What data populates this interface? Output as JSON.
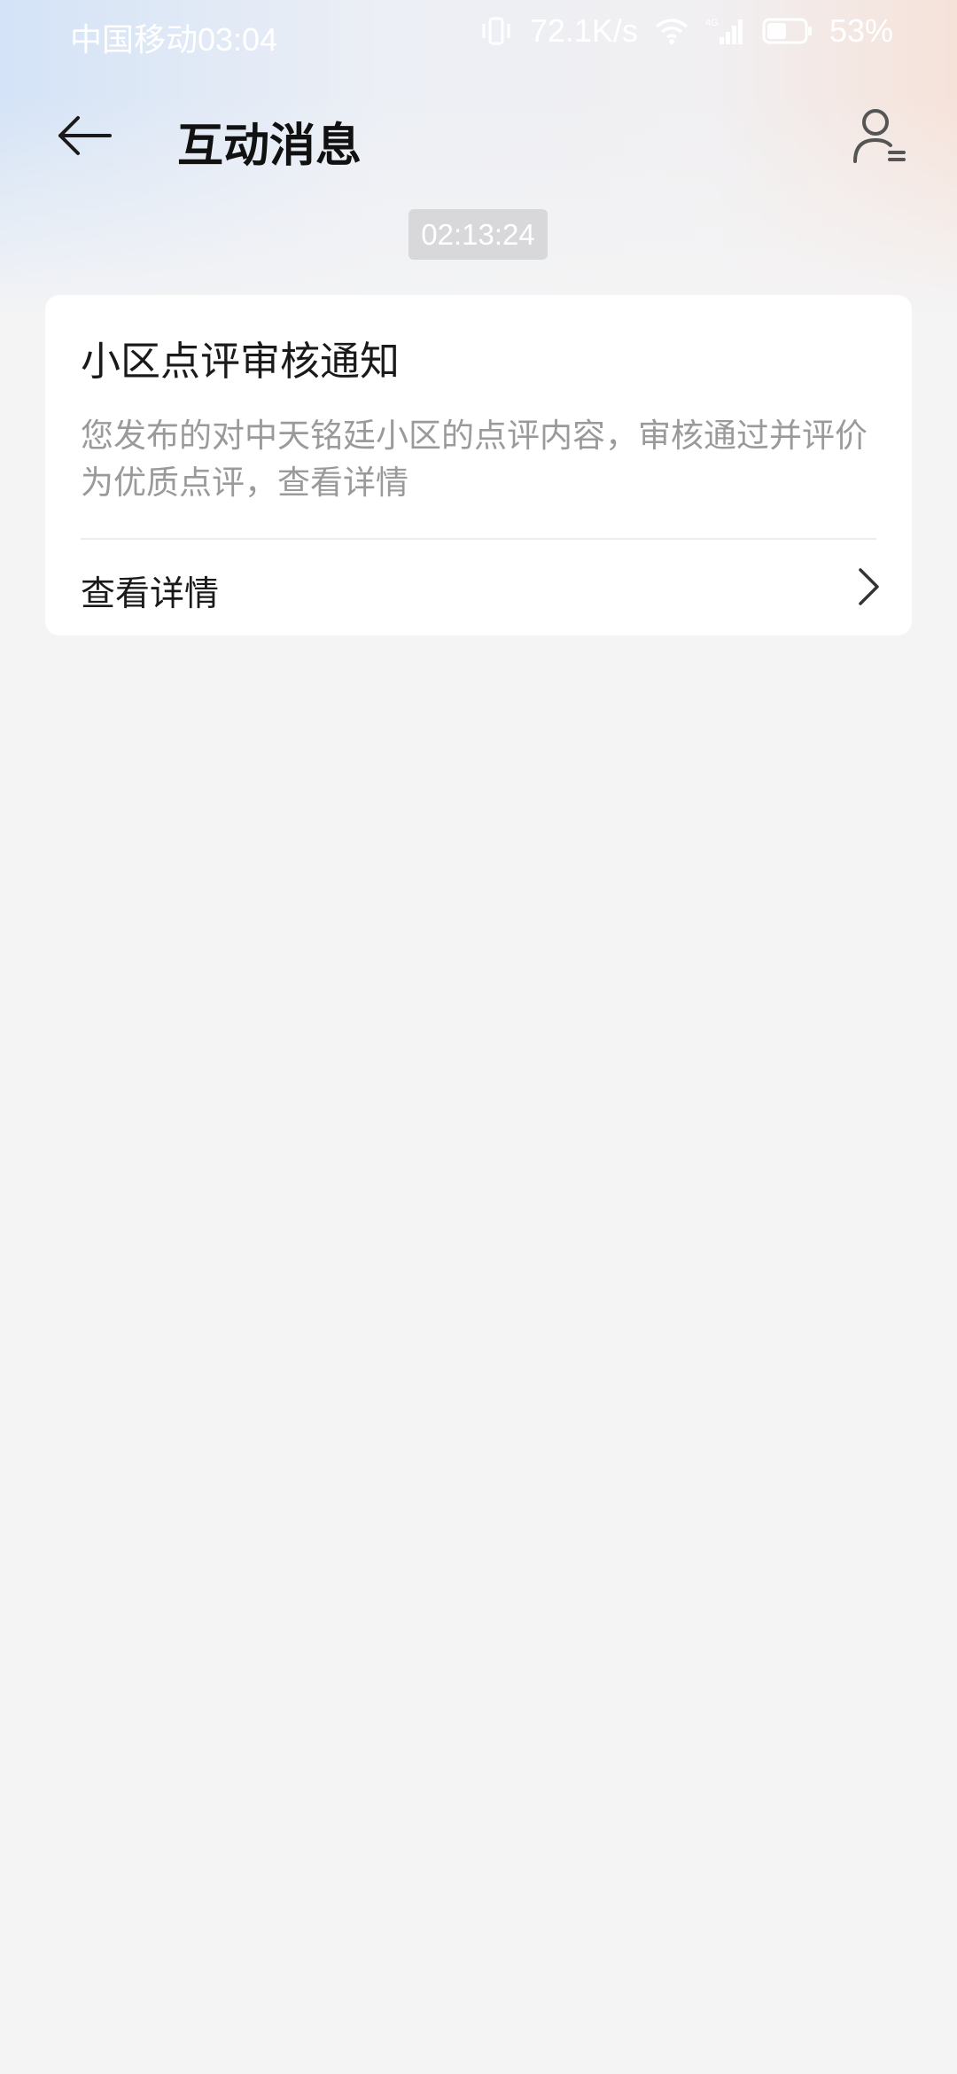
{
  "status_bar": {
    "carrier": "中国移动",
    "time": "03:04",
    "network_speed": "72.1K/s",
    "battery_percent": "53%",
    "battery_level": 0.53,
    "network_type_badge": "4G"
  },
  "header": {
    "title": "互动消息",
    "back_icon": "arrow-left-icon",
    "profile_icon": "user-settings-icon"
  },
  "messages": [
    {
      "timestamp": "02:13:24",
      "title": "小区点评审核通知",
      "body": "您发布的对中天铭廷小区的点评内容，审核通过并评价为优质点评，查看详情",
      "link_label": "查看详情"
    }
  ],
  "colors": {
    "page_background": "#f4f4f5",
    "card_background": "#ffffff",
    "title_text": "#111111",
    "body_text": "#9a9a9a",
    "timestamp_pill": "#d8d8da"
  }
}
